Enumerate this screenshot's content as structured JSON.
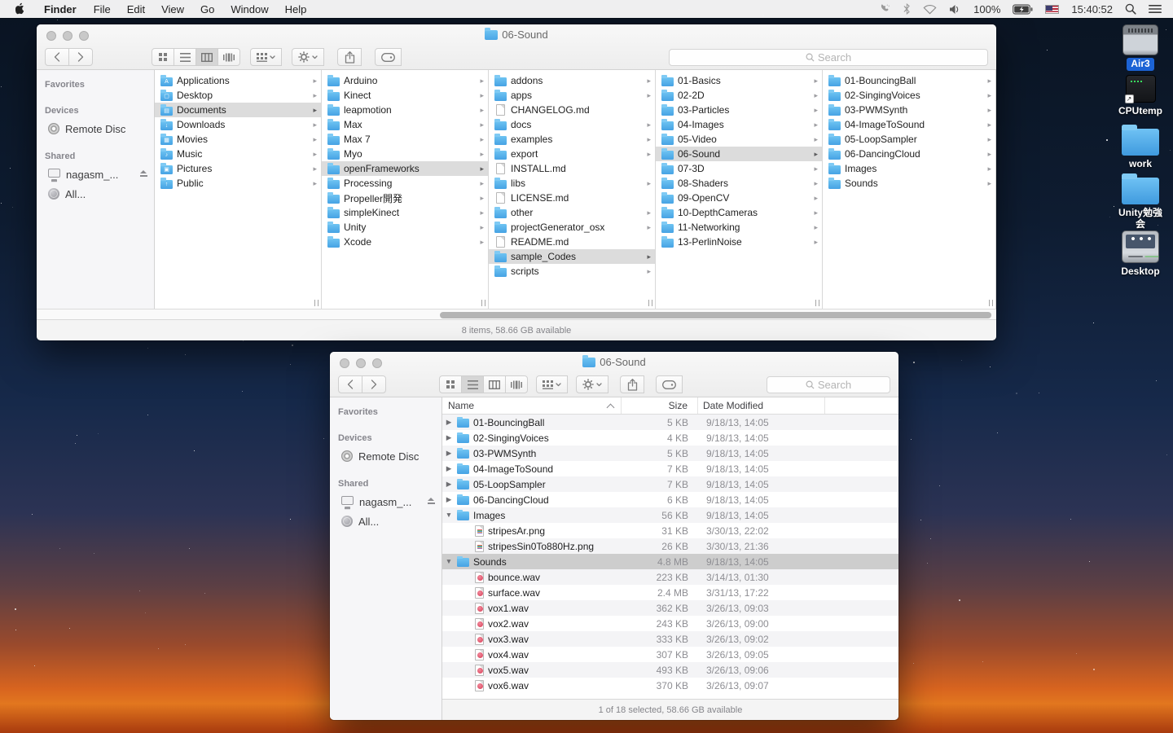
{
  "menu_bar": {
    "items": [
      {
        "label": "Finder",
        "bold": true
      },
      {
        "label": "File"
      },
      {
        "label": "Edit"
      },
      {
        "label": "View"
      },
      {
        "label": "Go"
      },
      {
        "label": "Window"
      },
      {
        "label": "Help"
      }
    ],
    "battery_pct": "100%",
    "clock": "15:40:52"
  },
  "shared_sidebar": [
    {
      "kind": "header",
      "label": "Favorites"
    },
    {
      "kind": "header",
      "label": "Devices",
      "gap": true
    },
    {
      "kind": "item",
      "label": "Remote Disc",
      "icon": "disc"
    },
    {
      "kind": "header",
      "label": "Shared",
      "gap": true
    },
    {
      "kind": "item",
      "label": "nagasm_...",
      "icon": "display",
      "eject": true
    },
    {
      "kind": "item",
      "label": "All...",
      "icon": "network"
    }
  ],
  "window_main": {
    "title": "06-Sound",
    "search_placeholder": "Search",
    "status_text": "8 items, 58.66 GB available",
    "columns": {
      "c1": [
        {
          "label": "Applications",
          "type": "folder",
          "glyph": "A",
          "arrow": true
        },
        {
          "label": "Desktop",
          "type": "folder",
          "glyph": "▢",
          "arrow": true
        },
        {
          "label": "Documents",
          "type": "folder",
          "glyph": "▤",
          "arrow": true,
          "selected": true
        },
        {
          "label": "Downloads",
          "type": "folder",
          "glyph": "↓",
          "arrow": true
        },
        {
          "label": "Movies",
          "type": "folder",
          "glyph": "▦",
          "arrow": true
        },
        {
          "label": "Music",
          "type": "folder",
          "glyph": "♪",
          "arrow": true
        },
        {
          "label": "Pictures",
          "type": "folder",
          "glyph": "▣",
          "arrow": true
        },
        {
          "label": "Public",
          "type": "folder",
          "glyph": "↑",
          "arrow": true
        }
      ],
      "c2": [
        {
          "label": "Arduino",
          "type": "folder",
          "arrow": true
        },
        {
          "label": "Kinect",
          "type": "folder",
          "arrow": true
        },
        {
          "label": "leapmotion",
          "type": "folder",
          "arrow": true
        },
        {
          "label": "Max",
          "type": "folder",
          "arrow": true
        },
        {
          "label": "Max 7",
          "type": "folder",
          "arrow": true
        },
        {
          "label": "Myo",
          "type": "folder",
          "arrow": true
        },
        {
          "label": "openFrameworks",
          "type": "folder",
          "arrow": true,
          "selected": true
        },
        {
          "label": "Processing",
          "type": "folder",
          "arrow": true
        },
        {
          "label": "Propeller開発",
          "type": "folder",
          "arrow": true
        },
        {
          "label": "simpleKinect",
          "type": "folder",
          "arrow": true
        },
        {
          "label": "Unity",
          "type": "folder",
          "arrow": true
        },
        {
          "label": "Xcode",
          "type": "folder",
          "arrow": true
        }
      ],
      "c3": [
        {
          "label": "addons",
          "type": "folder",
          "arrow": true
        },
        {
          "label": "apps",
          "type": "folder",
          "arrow": true
        },
        {
          "label": "CHANGELOG.md",
          "type": "doc"
        },
        {
          "label": "docs",
          "type": "folder",
          "arrow": true
        },
        {
          "label": "examples",
          "type": "folder",
          "arrow": true
        },
        {
          "label": "export",
          "type": "folder",
          "arrow": true
        },
        {
          "label": "INSTALL.md",
          "type": "doc"
        },
        {
          "label": "libs",
          "type": "folder",
          "arrow": true
        },
        {
          "label": "LICENSE.md",
          "type": "doc"
        },
        {
          "label": "other",
          "type": "folder",
          "arrow": true
        },
        {
          "label": "projectGenerator_osx",
          "type": "folder",
          "arrow": true
        },
        {
          "label": "README.md",
          "type": "doc"
        },
        {
          "label": "sample_Codes",
          "type": "folder",
          "arrow": true,
          "selected": true
        },
        {
          "label": "scripts",
          "type": "folder",
          "arrow": true
        }
      ],
      "c4": [
        {
          "label": "01-Basics",
          "type": "folder",
          "arrow": true
        },
        {
          "label": "02-2D",
          "type": "folder",
          "arrow": true
        },
        {
          "label": "03-Particles",
          "type": "folder",
          "arrow": true
        },
        {
          "label": "04-Images",
          "type": "folder",
          "arrow": true
        },
        {
          "label": "05-Video",
          "type": "folder",
          "arrow": true
        },
        {
          "label": "06-Sound",
          "type": "folder",
          "arrow": true,
          "selected": true
        },
        {
          "label": "07-3D",
          "type": "folder",
          "arrow": true
        },
        {
          "label": "08-Shaders",
          "type": "folder",
          "arrow": true
        },
        {
          "label": "09-OpenCV",
          "type": "folder",
          "arrow": true
        },
        {
          "label": "10-DepthCameras",
          "type": "folder",
          "arrow": true
        },
        {
          "label": "11-Networking",
          "type": "folder",
          "arrow": true
        },
        {
          "label": "13-PerlinNoise",
          "type": "folder",
          "arrow": true
        }
      ],
      "c5": [
        {
          "label": "01-BouncingBall",
          "type": "folder",
          "arrow": true
        },
        {
          "label": "02-SingingVoices",
          "type": "folder",
          "arrow": true
        },
        {
          "label": "03-PWMSynth",
          "type": "folder",
          "arrow": true
        },
        {
          "label": "04-ImageToSound",
          "type": "folder",
          "arrow": true
        },
        {
          "label": "05-LoopSampler",
          "type": "folder",
          "arrow": true
        },
        {
          "label": "06-DancingCloud",
          "type": "folder",
          "arrow": true
        },
        {
          "label": "Images",
          "type": "folder",
          "arrow": true
        },
        {
          "label": "Sounds",
          "type": "folder",
          "arrow": true
        }
      ]
    }
  },
  "window_list": {
    "title": "06-Sound",
    "search_placeholder": "Search",
    "status_text": "1 of 18 selected, 58.66 GB available",
    "list_headers": {
      "name": "Name",
      "size": "Size",
      "date": "Date Modified"
    },
    "rows": [
      {
        "name": "01-BouncingBall",
        "size": "5 KB",
        "date": "9/18/13, 14:05",
        "type": "folder",
        "can": true
      },
      {
        "name": "02-SingingVoices",
        "size": "4 KB",
        "date": "9/18/13, 14:05",
        "type": "folder",
        "can": true
      },
      {
        "name": "03-PWMSynth",
        "size": "5 KB",
        "date": "9/18/13, 14:05",
        "type": "folder",
        "can": true
      },
      {
        "name": "04-ImageToSound",
        "size": "7 KB",
        "date": "9/18/13, 14:05",
        "type": "folder",
        "can": true
      },
      {
        "name": "05-LoopSampler",
        "size": "7 KB",
        "date": "9/18/13, 14:05",
        "type": "folder",
        "can": true
      },
      {
        "name": "06-DancingCloud",
        "size": "6 KB",
        "date": "9/18/13, 14:05",
        "type": "folder",
        "can": true
      },
      {
        "name": "Images",
        "size": "56 KB",
        "date": "9/18/13, 14:05",
        "type": "folder",
        "can": true,
        "exp": true
      },
      {
        "name": "stripesAr.png",
        "size": "31 KB",
        "date": "3/30/13, 22:02",
        "type": "png",
        "child": true
      },
      {
        "name": "stripesSin0To880Hz.png",
        "size": "26 KB",
        "date": "3/30/13, 21:36",
        "type": "png",
        "child": true
      },
      {
        "name": "Sounds",
        "size": "4.8 MB",
        "date": "9/18/13, 14:05",
        "type": "folder",
        "can": true,
        "exp": true,
        "selected": true
      },
      {
        "name": "bounce.wav",
        "size": "223 KB",
        "date": "3/14/13, 01:30",
        "type": "wav",
        "child": true
      },
      {
        "name": "surface.wav",
        "size": "2.4 MB",
        "date": "3/31/13, 17:22",
        "type": "wav",
        "child": true
      },
      {
        "name": "vox1.wav",
        "size": "362 KB",
        "date": "3/26/13, 09:03",
        "type": "wav",
        "child": true
      },
      {
        "name": "vox2.wav",
        "size": "243 KB",
        "date": "3/26/13, 09:00",
        "type": "wav",
        "child": true
      },
      {
        "name": "vox3.wav",
        "size": "333 KB",
        "date": "3/26/13, 09:02",
        "type": "wav",
        "child": true
      },
      {
        "name": "vox4.wav",
        "size": "307 KB",
        "date": "3/26/13, 09:05",
        "type": "wav",
        "child": true
      },
      {
        "name": "vox5.wav",
        "size": "493 KB",
        "date": "3/26/13, 09:06",
        "type": "wav",
        "child": true
      },
      {
        "name": "vox6.wav",
        "size": "370 KB",
        "date": "3/26/13, 09:07",
        "type": "wav",
        "child": true
      }
    ]
  },
  "desktop_icons": [
    {
      "label": "Air3",
      "type": "harddrive",
      "selected": true
    },
    {
      "label": "CPUtemp",
      "type": "terminal",
      "alias": true
    },
    {
      "label": "work",
      "type": "folder"
    },
    {
      "label": "Unity勉強会",
      "type": "folder"
    },
    {
      "label": "Desktop",
      "type": "network"
    }
  ],
  "colors": {
    "folder_blue": "#58b2ee",
    "selection_gray": "#cdcdcd",
    "label_select_blue": "#1c63d5"
  }
}
